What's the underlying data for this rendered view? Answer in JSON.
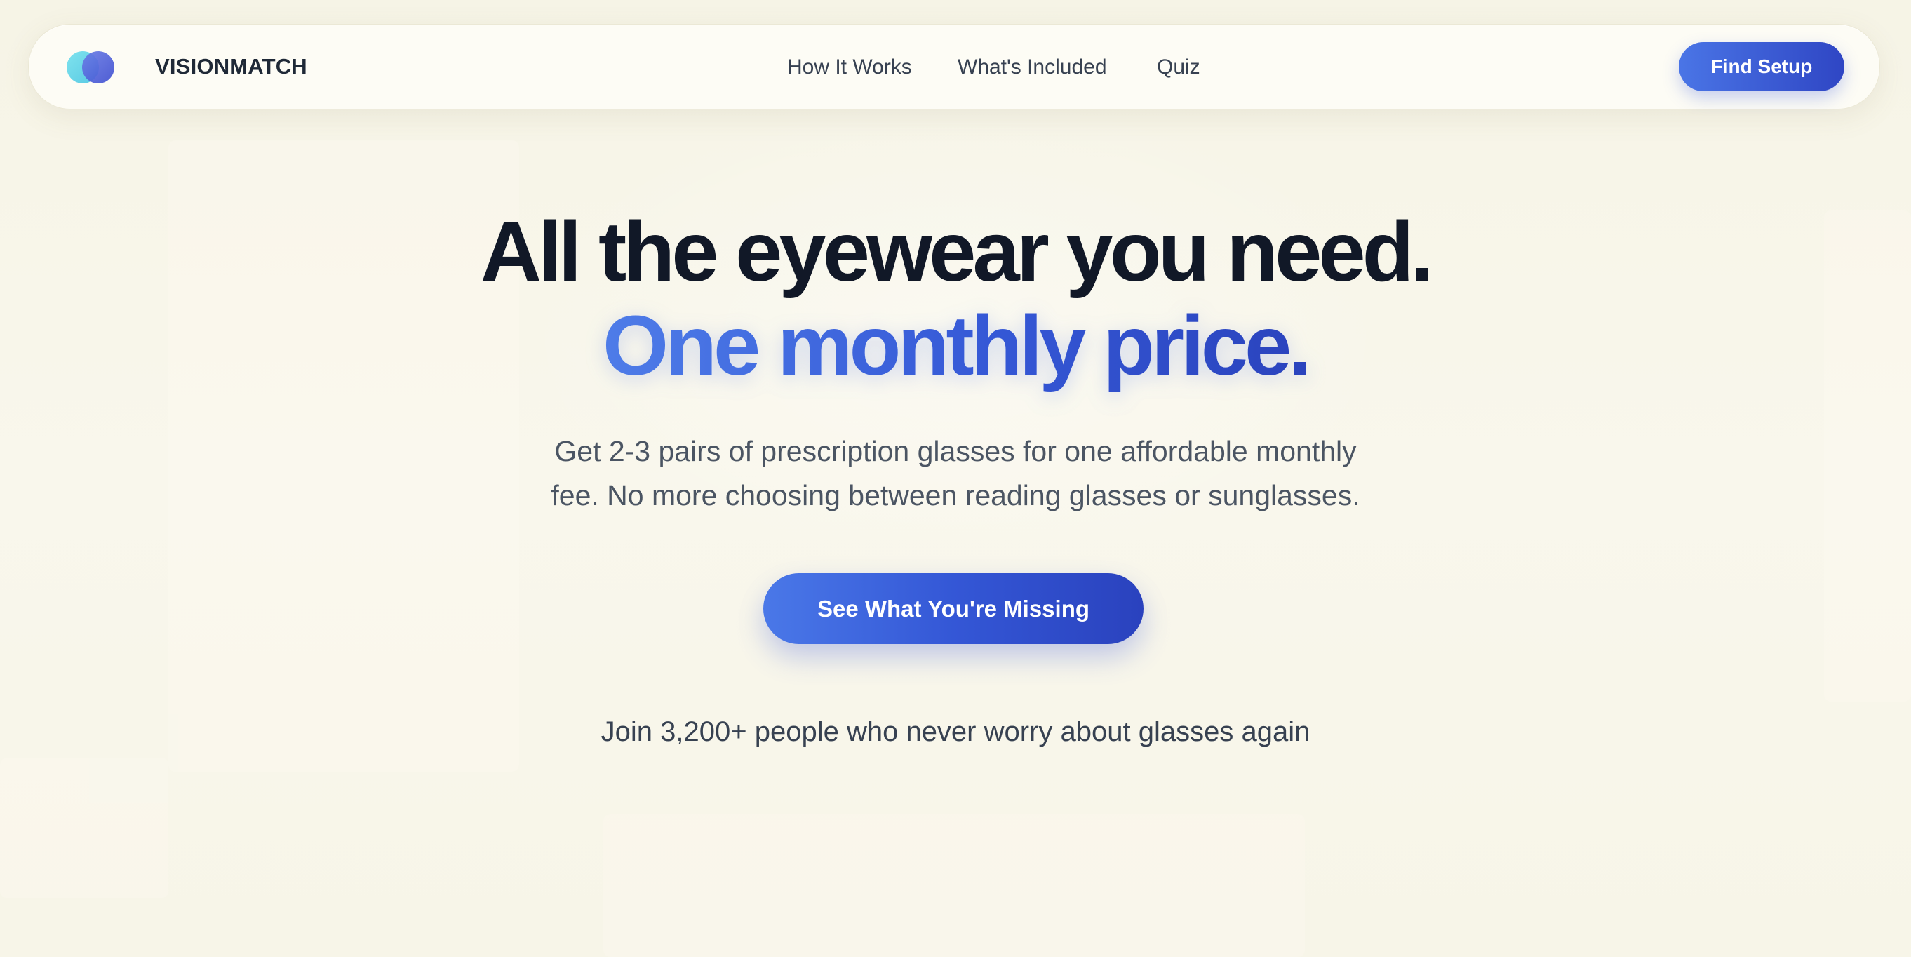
{
  "header": {
    "brand": "VISIONMATCH",
    "nav": [
      "How It Works",
      "What's Included",
      "Quiz"
    ],
    "cta_label": "Find Setup"
  },
  "hero": {
    "title_line1": "All the eyewear you need.",
    "title_line2": "One monthly price.",
    "subtitle_line1": "Get 2-3 pairs of prescription glasses for one affordable monthly",
    "subtitle_line2": "fee. No more choosing between reading glasses or sunglasses.",
    "cta_label": "See What You're Missing",
    "social_proof": "Join 3,200+ people who never worry about glasses again"
  },
  "colors": {
    "background": "#f8f6ea",
    "accent_start": "#4a78e8",
    "accent_end": "#2a42be",
    "heading": "#111827",
    "body_text": "#4b5563"
  },
  "icons": {
    "logo": "two-overlapping-circles-icon"
  }
}
